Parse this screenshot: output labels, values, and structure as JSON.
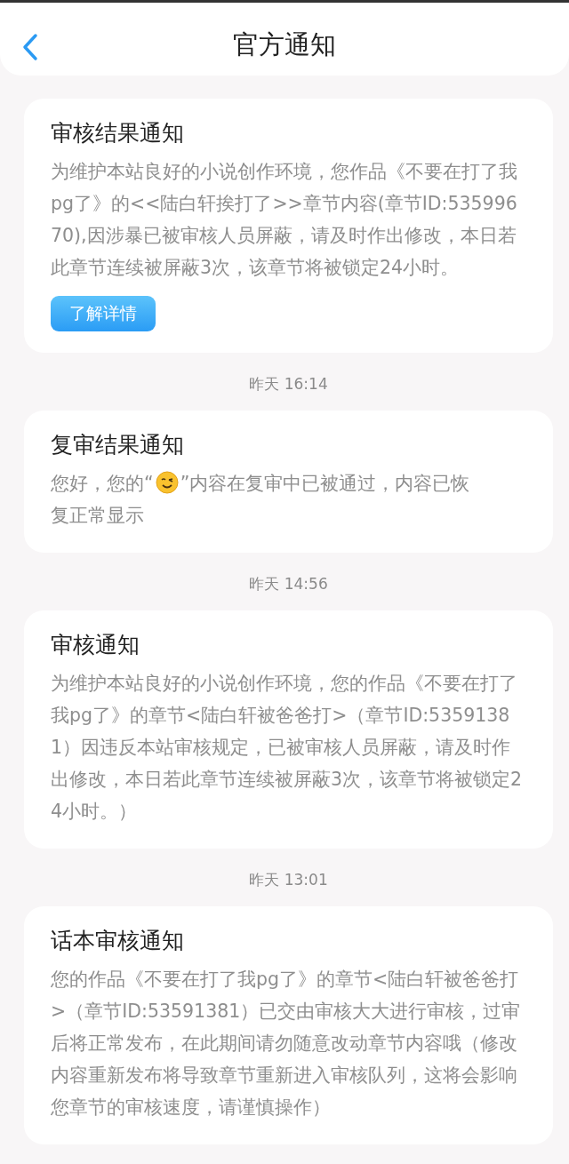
{
  "header": {
    "title": "官方通知"
  },
  "feed": [
    {
      "kind": "card",
      "title": "审核结果通知",
      "body": [
        {
          "kind": "text",
          "text": "为维护本站良好的小说创作环境，您作品《不要在打了我pg了》的<<陆白轩挨打了>>章节内容(章节ID:53599670),因涉暴已被审核人员屏蔽，请及时作出修改，本日若此章节连续被屏蔽3次，该章节将被锁定24小时。"
        }
      ],
      "button": "了解详情"
    },
    {
      "kind": "time",
      "text": "昨天 16:14"
    },
    {
      "kind": "card",
      "title": "复审结果通知",
      "body": [
        {
          "kind": "text",
          "text": "您好，您的“"
        },
        {
          "kind": "emoji"
        },
        {
          "kind": "text",
          "text": "”内容在复审中已被通过，内容已恢"
        },
        {
          "kind": "text",
          "text": "复正常显示"
        }
      ]
    },
    {
      "kind": "time",
      "text": "昨天 14:56"
    },
    {
      "kind": "card",
      "title": "审核通知",
      "body": [
        {
          "kind": "text",
          "text": "为维护本站良好的小说创作环境，您的作品《不要在打了我pg了》的章节<陆白轩被爸爸打>（章节ID:53591381）因违反本站审核规定，已被审核人员屏蔽，请及时作出修改，本日若此章节连续被屏蔽3次，该章节将被锁定24小时。）"
        }
      ]
    },
    {
      "kind": "time",
      "text": "昨天 13:01"
    },
    {
      "kind": "card",
      "title": "话本审核通知",
      "body": [
        {
          "kind": "text",
          "text": "您的作品《不要在打了我pg了》的章节<陆白轩被爸爸打>（章节ID:53591381）已交由审核大大进行审核，过审后将正常发布，在此期间请勿随意改动章节内容哦（修改内容重新发布将导致章节重新进入审核队列，这将会影响您章节的审核速度，请谨慎操作）"
        }
      ]
    }
  ]
}
